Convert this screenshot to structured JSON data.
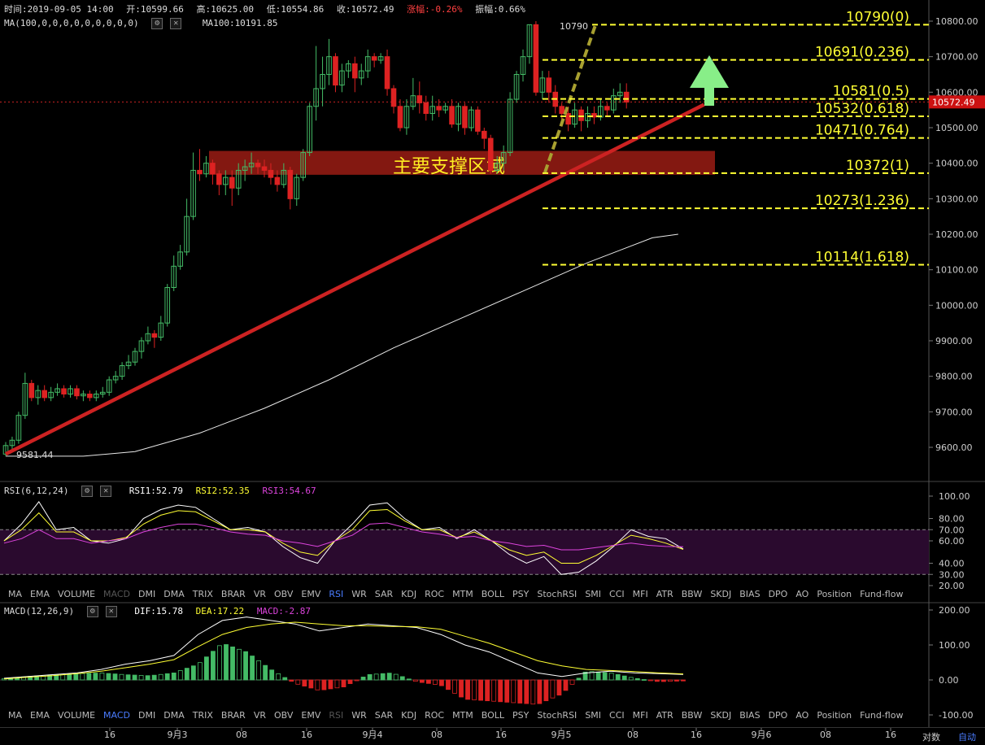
{
  "header": {
    "time": "时间:2019-09-05 14:00",
    "open": "开:10599.66",
    "high": "高:10625.00",
    "low": "低:10554.86",
    "close": "收:10572.49",
    "change": "涨幅:-0.26%",
    "amplitude": "振幅:0.66%",
    "ma_title": "MA(100,0,0,0,0,0,0,0,0,0)",
    "ma_value": "MA100:10191.85"
  },
  "rsi_header": {
    "title": "RSI(6,12,24)",
    "rsi1": "RSI1:52.79",
    "rsi2": "RSI2:52.35",
    "rsi3": "RSI3:54.67"
  },
  "macd_header": {
    "title": "MACD(12,26,9)",
    "dif": "DIF:15.78",
    "dea": "DEA:17.22",
    "macd": "MACD:-2.87"
  },
  "tabs": [
    "MA",
    "EMA",
    "VOLUME",
    "MACD",
    "DMI",
    "DMA",
    "TRIX",
    "BRAR",
    "VR",
    "OBV",
    "EMV",
    "RSI",
    "WR",
    "SAR",
    "KDJ",
    "ROC",
    "MTM",
    "BOLL",
    "PSY",
    "StochRSI",
    "SMI",
    "CCI",
    "MFI",
    "ATR",
    "BBW",
    "SKDJ",
    "BIAS",
    "DPO",
    "AO",
    "Position",
    "Fund-flow"
  ],
  "bottom": {
    "contrast": "对数",
    "auto": "自动"
  },
  "colors": {
    "up": "#44bb66",
    "down": "#dd2222",
    "fib": "#ffff33",
    "trend": "#cc2222",
    "arrow": "#88ee88",
    "zone": "#9a1c14"
  },
  "chart_data": [
    {
      "type": "candlestick",
      "title": "",
      "ylim": [
        9540,
        10835
      ],
      "yticks": [
        "10800.00",
        "10700.00",
        "10600.00",
        "10500.00",
        "10400.00",
        "10300.00",
        "10200.00",
        "10100.00",
        "10000.00",
        "9900.00",
        "9800.00",
        "9700.00",
        "9600.00"
      ],
      "xticks": [
        "16",
        "9月3",
        "08",
        "16",
        "9月4",
        "08",
        "16",
        "9月5",
        "08",
        "16",
        "9月6",
        "08",
        "16"
      ],
      "last_price": "10572.49",
      "annotations": {
        "high_label": "10790",
        "low_label": "9581.44",
        "zone_label": "主要支撑区域"
      },
      "fib_levels": [
        {
          "price": 10790,
          "label": "10790(0)"
        },
        {
          "price": 10691,
          "label": "10691(0.236)"
        },
        {
          "price": 10581,
          "label": "10581(0.5)"
        },
        {
          "price": 10532,
          "label": "10532(0.618)"
        },
        {
          "price": 10471,
          "label": "10471(0.764)"
        },
        {
          "price": 10372,
          "label": "10372(1)"
        },
        {
          "price": 10273,
          "label": "10273(1.236)"
        },
        {
          "price": 10114,
          "label": "10114(1.618)"
        }
      ],
      "support_zone": [
        10372,
        10430
      ],
      "trendline": [
        [
          0,
          9581
        ],
        [
          108,
          10565
        ]
      ],
      "ma100": [
        [
          0,
          9575
        ],
        [
          12,
          9575
        ],
        [
          20,
          9588
        ],
        [
          30,
          9640
        ],
        [
          40,
          9710
        ],
        [
          50,
          9790
        ],
        [
          60,
          9880
        ],
        [
          70,
          9960
        ],
        [
          80,
          10040
        ],
        [
          90,
          10120
        ],
        [
          100,
          10190
        ],
        [
          104,
          10200
        ]
      ],
      "candles": [
        [
          9581,
          9605,
          9575,
          9615
        ],
        [
          9605,
          9620,
          9595,
          9630
        ],
        [
          9620,
          9690,
          9610,
          9700
        ],
        [
          9690,
          9780,
          9680,
          9810
        ],
        [
          9780,
          9740,
          9730,
          9790
        ],
        [
          9740,
          9760,
          9720,
          9775
        ],
        [
          9760,
          9740,
          9730,
          9775
        ],
        [
          9740,
          9755,
          9730,
          9770
        ],
        [
          9755,
          9765,
          9745,
          9780
        ],
        [
          9765,
          9750,
          9740,
          9775
        ],
        [
          9750,
          9765,
          9740,
          9775
        ],
        [
          9765,
          9745,
          9735,
          9775
        ],
        [
          9745,
          9750,
          9730,
          9760
        ],
        [
          9750,
          9740,
          9730,
          9760
        ],
        [
          9740,
          9750,
          9730,
          9760
        ],
        [
          9750,
          9755,
          9740,
          9770
        ],
        [
          9755,
          9790,
          9745,
          9800
        ],
        [
          9790,
          9800,
          9780,
          9815
        ],
        [
          9800,
          9830,
          9790,
          9840
        ],
        [
          9830,
          9840,
          9820,
          9860
        ],
        [
          9840,
          9870,
          9830,
          9880
        ],
        [
          9870,
          9900,
          9850,
          9910
        ],
        [
          9900,
          9920,
          9890,
          9940
        ],
        [
          9920,
          9910,
          9880,
          9930
        ],
        [
          9910,
          9950,
          9900,
          9970
        ],
        [
          9950,
          10050,
          9940,
          10060
        ],
        [
          10050,
          10110,
          10040,
          10140
        ],
        [
          10110,
          10150,
          10100,
          10170
        ],
        [
          10150,
          10250,
          10140,
          10300
        ],
        [
          10250,
          10380,
          10240,
          10430
        ],
        [
          10380,
          10370,
          10350,
          10440
        ],
        [
          10370,
          10400,
          10360,
          10420
        ],
        [
          10400,
          10370,
          10340,
          10410
        ],
        [
          10370,
          10340,
          10310,
          10380
        ],
        [
          10340,
          10360,
          10310,
          10380
        ],
        [
          10360,
          10330,
          10280,
          10380
        ],
        [
          10330,
          10380,
          10310,
          10400
        ],
        [
          10380,
          10390,
          10350,
          10410
        ],
        [
          10390,
          10400,
          10370,
          10430
        ],
        [
          10400,
          10390,
          10370,
          10410
        ],
        [
          10390,
          10380,
          10360,
          10410
        ],
        [
          10380,
          10360,
          10340,
          10400
        ],
        [
          10360,
          10340,
          10320,
          10380
        ],
        [
          10340,
          10380,
          10330,
          10400
        ],
        [
          10380,
          10300,
          10270,
          10390
        ],
        [
          10300,
          10360,
          10280,
          10370
        ],
        [
          10360,
          10430,
          10350,
          10440
        ],
        [
          10430,
          10560,
          10420,
          10570
        ],
        [
          10560,
          10610,
          10520,
          10730
        ],
        [
          10610,
          10650,
          10560,
          10700
        ],
        [
          10650,
          10700,
          10620,
          10750
        ],
        [
          10700,
          10620,
          10600,
          10710
        ],
        [
          10620,
          10660,
          10600,
          10680
        ],
        [
          10660,
          10680,
          10640,
          10690
        ],
        [
          10680,
          10640,
          10600,
          10700
        ],
        [
          10640,
          10660,
          10620,
          10680
        ],
        [
          10660,
          10700,
          10640,
          10720
        ],
        [
          10700,
          10690,
          10670,
          10710
        ],
        [
          10690,
          10700,
          10680,
          10710
        ],
        [
          10700,
          10610,
          10590,
          10720
        ],
        [
          10610,
          10560,
          10540,
          10620
        ],
        [
          10560,
          10500,
          10490,
          10580
        ],
        [
          10500,
          10560,
          10480,
          10580
        ],
        [
          10560,
          10590,
          10550,
          10640
        ],
        [
          10590,
          10570,
          10540,
          10630
        ],
        [
          10570,
          10540,
          10520,
          10590
        ],
        [
          10540,
          10560,
          10520,
          10590
        ],
        [
          10560,
          10550,
          10530,
          10580
        ],
        [
          10550,
          10560,
          10540,
          10570
        ],
        [
          10560,
          10510,
          10500,
          10580
        ],
        [
          10510,
          10560,
          10490,
          10570
        ],
        [
          10560,
          10500,
          10480,
          10570
        ],
        [
          10500,
          10550,
          10490,
          10560
        ],
        [
          10550,
          10490,
          10480,
          10560
        ],
        [
          10490,
          10470,
          10440,
          10500
        ],
        [
          10470,
          10380,
          10370,
          10480
        ],
        [
          10380,
          10400,
          10370,
          10420
        ],
        [
          10400,
          10430,
          10380,
          10450
        ],
        [
          10430,
          10580,
          10420,
          10600
        ],
        [
          10580,
          10650,
          10570,
          10660
        ],
        [
          10650,
          10700,
          10630,
          10720
        ],
        [
          10700,
          10790,
          10680,
          10790
        ],
        [
          10790,
          10600,
          10590,
          10800
        ],
        [
          10600,
          10640,
          10580,
          10660
        ],
        [
          10640,
          10600,
          10570,
          10660
        ],
        [
          10600,
          10560,
          10540,
          10620
        ],
        [
          10560,
          10540,
          10510,
          10570
        ],
        [
          10540,
          10510,
          10490,
          10560
        ],
        [
          10510,
          10550,
          10500,
          10570
        ],
        [
          10550,
          10520,
          10490,
          10560
        ],
        [
          10520,
          10540,
          10500,
          10560
        ],
        [
          10540,
          10530,
          10510,
          10560
        ],
        [
          10530,
          10560,
          10520,
          10580
        ],
        [
          10560,
          10550,
          10530,
          10570
        ],
        [
          10550,
          10590,
          10540,
          10610
        ],
        [
          10590,
          10600,
          10570,
          10625
        ],
        [
          10600,
          10572,
          10554,
          10625
        ]
      ]
    },
    {
      "type": "line",
      "title": "",
      "ylim": [
        15,
        108
      ],
      "yticks": [
        "100.00",
        "80.00",
        "70.00",
        "60.00",
        "40.00",
        "30.00",
        "20.00"
      ],
      "bands": [
        30,
        70
      ],
      "series": [
        {
          "name": "RSI1",
          "color": "#ffffff",
          "values": [
            60,
            75,
            95,
            70,
            72,
            60,
            58,
            62,
            80,
            88,
            92,
            90,
            80,
            70,
            72,
            68,
            55,
            45,
            40,
            60,
            75,
            92,
            94,
            80,
            70,
            72,
            62,
            70,
            60,
            48,
            40,
            46,
            30,
            32,
            42,
            55,
            70,
            64,
            62,
            52.79
          ]
        },
        {
          "name": "RSI2",
          "color": "#ffff33",
          "values": [
            60,
            70,
            85,
            68,
            68,
            60,
            60,
            63,
            75,
            83,
            87,
            86,
            78,
            70,
            70,
            68,
            58,
            50,
            47,
            60,
            70,
            87,
            88,
            78,
            70,
            70,
            63,
            68,
            60,
            52,
            47,
            50,
            40,
            40,
            47,
            56,
            65,
            62,
            58,
            52.35
          ]
        },
        {
          "name": "RSI3",
          "color": "#dd44dd",
          "values": [
            58,
            62,
            70,
            62,
            62,
            58,
            60,
            62,
            68,
            72,
            75,
            75,
            72,
            68,
            66,
            65,
            60,
            58,
            55,
            60,
            65,
            75,
            76,
            72,
            68,
            66,
            63,
            64,
            60,
            58,
            55,
            56,
            52,
            52,
            54,
            56,
            58,
            56,
            55,
            54.67
          ]
        }
      ]
    },
    {
      "type": "bar",
      "title": "",
      "ylim": [
        -105,
        210
      ],
      "yticks": [
        "200.00",
        "100.00",
        "0.00",
        "-100.00"
      ],
      "series": [
        {
          "name": "DIF",
          "color": "#ffffff",
          "values": [
            5,
            10,
            15,
            20,
            30,
            45,
            55,
            70,
            130,
            170,
            180,
            170,
            160,
            140,
            150,
            160,
            155,
            150,
            130,
            100,
            80,
            50,
            20,
            10,
            20,
            25,
            20,
            18,
            15.78
          ]
        },
        {
          "name": "DEA",
          "color": "#ffff33",
          "values": [
            3,
            8,
            12,
            18,
            25,
            35,
            45,
            58,
            95,
            130,
            150,
            160,
            165,
            160,
            155,
            155,
            153,
            152,
            145,
            125,
            105,
            80,
            55,
            40,
            30,
            27,
            24,
            20,
            17.22
          ]
        },
        {
          "name": "MACD",
          "values": [
            4,
            10,
            15,
            18,
            20,
            15,
            12,
            20,
            45,
            105,
            80,
            30,
            -10,
            -30,
            -20,
            15,
            20,
            -5,
            -15,
            -55,
            -60,
            -65,
            -70,
            -40,
            25,
            20,
            5,
            -5,
            -2.87
          ]
        }
      ]
    }
  ]
}
